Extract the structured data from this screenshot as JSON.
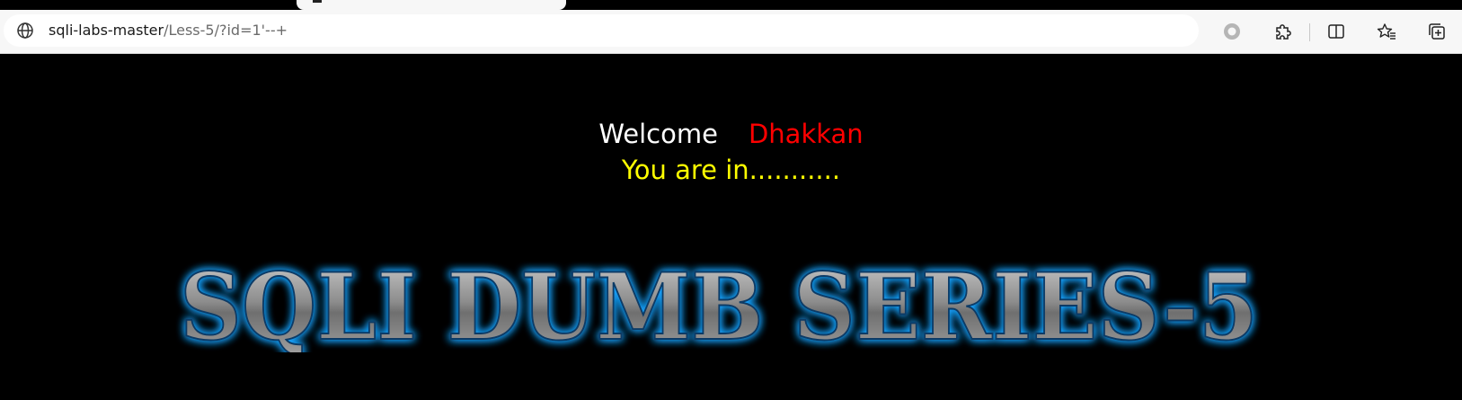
{
  "browser": {
    "address_bar": {
      "host": "sqli-labs-master",
      "path": "/Less-5/?id=1'--+"
    },
    "toolbar_icons": [
      "site-info-icon",
      "record-icon",
      "extensions-icon",
      "split-screen-icon",
      "favorites-icon",
      "collections-icon"
    ]
  },
  "page": {
    "welcome_label": "Welcome",
    "user_name": "Dhakkan",
    "status_message": "You are in...........",
    "banner_text": "SQLI DUMB SERIES-5"
  },
  "colors": {
    "background": "#000000",
    "welcome": "#ffffff",
    "user_name": "#ff0000",
    "status_message": "#ffff00",
    "banner_glow": "#1aa3ff",
    "banner_fill": "#8a8a8a"
  }
}
